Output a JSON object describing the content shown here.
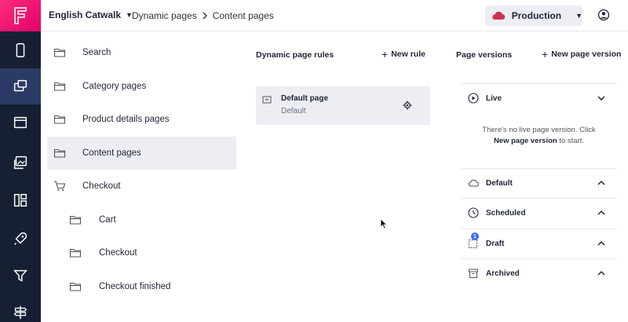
{
  "rail": {
    "logo": "F",
    "items": [
      {
        "name": "phone-icon"
      },
      {
        "name": "pages-icon",
        "active": true
      },
      {
        "name": "window-icon"
      },
      {
        "name": "media-icon"
      },
      {
        "name": "dashboard-icon"
      },
      {
        "name": "rocket-icon"
      },
      {
        "name": "filter-icon"
      },
      {
        "name": "signpost-icon"
      }
    ]
  },
  "topbar": {
    "project": "English Catwalk",
    "breadcrumb": [
      "Dynamic pages",
      "Content pages"
    ],
    "environment": "Production",
    "env_color": "#d0314b"
  },
  "page_types": [
    {
      "label": "Search",
      "icon": "folder-icon"
    },
    {
      "label": "Category pages",
      "icon": "folder-icon"
    },
    {
      "label": "Product details pages",
      "icon": "folder-icon"
    },
    {
      "label": "Content pages",
      "icon": "folder-icon",
      "active": true
    },
    {
      "label": "Checkout",
      "icon": "cart-icon"
    },
    {
      "label": "Cart",
      "icon": "folder-icon",
      "child": true
    },
    {
      "label": "Checkout",
      "icon": "folder-icon",
      "child": true
    },
    {
      "label": "Checkout finished",
      "icon": "folder-icon",
      "child": true
    }
  ],
  "rules": {
    "heading": "Dynamic page rules",
    "new_label": "New rule",
    "items": [
      {
        "title": "Default page",
        "subtitle": "Default"
      }
    ]
  },
  "versions": {
    "heading": "Page versions",
    "new_label": "New page version",
    "sections": [
      {
        "label": "Live",
        "icon": "play-circle-icon",
        "chevron": "down"
      },
      {
        "label": "Default",
        "icon": "cloud-icon",
        "chevron": "up"
      },
      {
        "label": "Scheduled",
        "icon": "clock-icon",
        "chevron": "up"
      },
      {
        "label": "Draft",
        "icon": "draft-icon",
        "chevron": "up",
        "badge": "1"
      },
      {
        "label": "Archived",
        "icon": "archive-icon",
        "chevron": "up"
      }
    ],
    "empty_text": "There's no live page version. Click",
    "empty_link": "New page version",
    "empty_suffix": " to start."
  }
}
